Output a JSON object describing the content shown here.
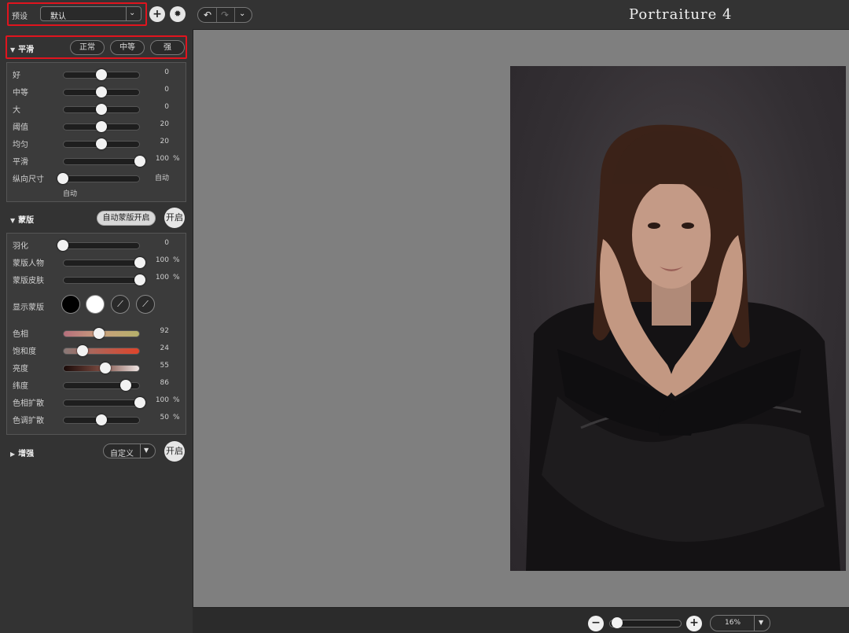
{
  "app_title": "Portraiture 4",
  "preset": {
    "label": "预设",
    "value": "默认"
  },
  "history": {
    "undo_icon": "undo-icon",
    "redo_icon": "redo-icon",
    "menu_icon": "chevron-down-icon"
  },
  "smoothing": {
    "title": "平滑",
    "buttons": [
      "正常",
      "中等",
      "强"
    ],
    "sliders": [
      {
        "label": "好",
        "value": "0",
        "unit": "",
        "fraction": 0.5
      },
      {
        "label": "中等",
        "value": "0",
        "unit": "",
        "fraction": 0.5
      },
      {
        "label": "大",
        "value": "0",
        "unit": "",
        "fraction": 0.5
      },
      {
        "label": "阈值",
        "value": "20",
        "unit": "",
        "fraction": 0.5
      },
      {
        "label": "均匀",
        "value": "20",
        "unit": "",
        "fraction": 0.5
      },
      {
        "label": "平滑",
        "value": "100",
        "unit": "%",
        "fraction": 1.0
      },
      {
        "label": "纵向尺寸",
        "value": "自动",
        "unit": "",
        "fraction": 0.0
      }
    ],
    "auto_note": "自动"
  },
  "mask": {
    "title": "蒙版",
    "auto_button": "自动蒙版开启",
    "toggle": "开启",
    "sliders": [
      {
        "label": "羽化",
        "value": "0",
        "unit": "",
        "fraction": 0.0
      },
      {
        "label": "蒙版人物",
        "value": "100",
        "unit": "%",
        "fraction": 1.0
      },
      {
        "label": "蒙版皮肤",
        "value": "100",
        "unit": "%",
        "fraction": 1.0
      }
    ],
    "show_mask_label": "显示蒙版",
    "color_sliders": [
      {
        "label": "色相",
        "value": "92",
        "unit": "",
        "fraction": 0.47
      },
      {
        "label": "饱和度",
        "value": "24",
        "unit": "",
        "fraction": 0.26
      },
      {
        "label": "亮度",
        "value": "55",
        "unit": "",
        "fraction": 0.55
      },
      {
        "label": "纬度",
        "value": "86",
        "unit": "",
        "fraction": 0.82
      },
      {
        "label": "色相扩散",
        "value": "100",
        "unit": "%",
        "fraction": 1.0
      },
      {
        "label": "色调扩散",
        "value": "50",
        "unit": "%",
        "fraction": 0.5
      }
    ]
  },
  "enhance": {
    "title": "增强",
    "preset": "自定义",
    "toggle": "开启"
  },
  "zoom": {
    "value": "16%",
    "fraction": 0.05
  },
  "colors": {
    "highlight": "#e0141e",
    "canvas": "#7f7f7f"
  }
}
